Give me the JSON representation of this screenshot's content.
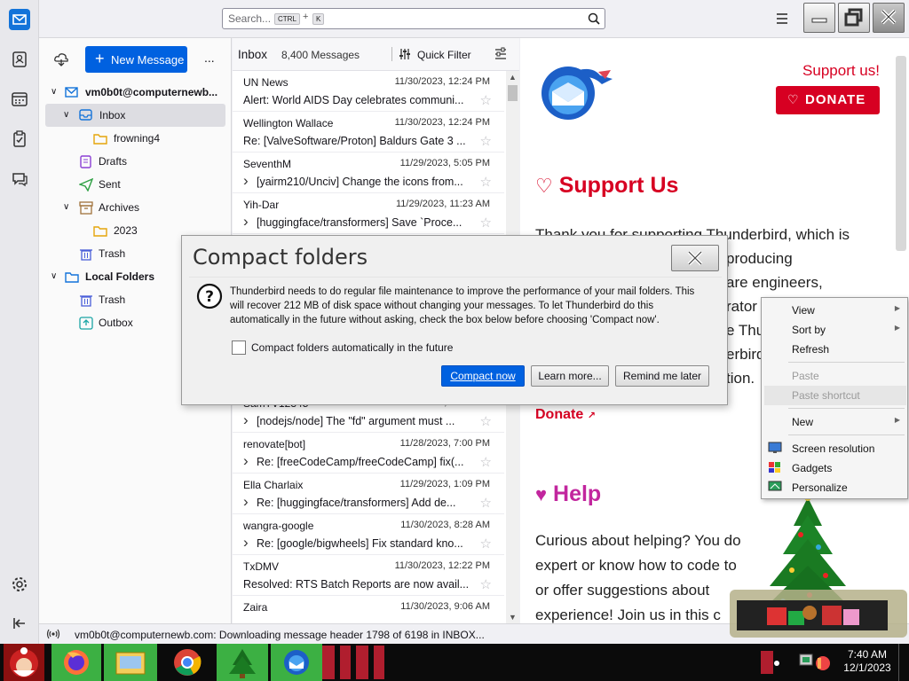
{
  "search": {
    "placeholder": "Search...",
    "kbd1": "CTRL",
    "plus": "+",
    "kbd2": "K"
  },
  "folder_pane": {
    "new_message": "New Message",
    "more": "...",
    "account": "vm0b0t@computernewb...",
    "folders": [
      {
        "label": "Inbox"
      },
      {
        "label": "frowning4"
      },
      {
        "label": "Drafts"
      },
      {
        "label": "Sent"
      },
      {
        "label": "Archives"
      },
      {
        "label": "2023"
      },
      {
        "label": "Trash"
      },
      {
        "label": "Local Folders"
      },
      {
        "label": "Trash"
      },
      {
        "label": "Outbox"
      }
    ]
  },
  "thread_pane": {
    "folder_name": "Inbox",
    "count": "8,400 Messages",
    "quick_filter": "Quick Filter",
    "messages": [
      {
        "from": "UN News",
        "date": "11/30/2023, 12:24 PM",
        "subject": "Alert: World AIDS Day celebrates communi..."
      },
      {
        "from": "Wellington Wallace",
        "date": "11/30/2023, 12:24 PM",
        "subject": "Re: [ValveSoftware/Proton] Baldurs Gate 3 ..."
      },
      {
        "from": "SeventhM",
        "date": "11/29/2023, 5:05 PM",
        "subject": "[yairm210/Unciv] Change the icons from..."
      },
      {
        "from": "Yih-Dar",
        "date": "11/29/2023, 11:23 AM",
        "subject": "[huggingface/transformers] Save `Proce..."
      },
      {
        "from": "SamTV12345",
        "date": "11/30/2023, 11:46 AM",
        "subject": "[nodejs/node] The \"fd\" argument must ..."
      },
      {
        "from": "renovate[bot]",
        "date": "11/28/2023, 7:00 PM",
        "subject": "Re: [freeCodeCamp/freeCodeCamp] fix(..."
      },
      {
        "from": "Ella Charlaix",
        "date": "11/29/2023, 1:09 PM",
        "subject": "Re: [huggingface/transformers] Add de..."
      },
      {
        "from": "wangra-google",
        "date": "11/30/2023, 8:28 AM",
        "subject": "Re: [google/bigwheels] Fix standard kno..."
      },
      {
        "from": "TxDMV",
        "date": "11/30/2023, 12:22 PM",
        "subject": "Resolved: RTS Batch Reports are now avail..."
      },
      {
        "from": "Zaira",
        "date": "11/30/2023, 9:06 AM",
        "subject": ""
      }
    ]
  },
  "content": {
    "support_us_link": "Support us!",
    "donate_button": "DONATE",
    "support_heading": "Support Us",
    "support_text": [
      "Thank you for supporting Thunderbird, which is",
      "producing",
      "are engineers,",
      "rator",
      "e Thu",
      "erbird",
      "tion."
    ],
    "donate_link": "Donate",
    "help_heading": "Help",
    "help_text": [
      "Curious about helping? You do",
      "expert or know how to code to",
      "or offer suggestions about",
      "experience! Join us in this c"
    ]
  },
  "dialog": {
    "title": "Compact folders",
    "message": "Thunderbird needs to do regular file maintenance to improve the performance of your mail folders. This will recover 212 MB of disk space without changing your messages. To let Thunderbird do this automatically in the future without asking, check the box below before choosing 'Compact now'.",
    "checkbox_label": "Compact folders automatically in the future",
    "buttons": {
      "compact": "Compact now",
      "learn": "Learn more...",
      "remind": "Remind me later"
    }
  },
  "context_menu": {
    "items": [
      {
        "label": "View"
      },
      {
        "label": "Sort by"
      },
      {
        "label": "Refresh"
      },
      {
        "label": "Paste"
      },
      {
        "label": "Paste shortcut"
      },
      {
        "label": "New"
      },
      {
        "label": "Screen resolution"
      },
      {
        "label": "Gadgets"
      },
      {
        "label": "Personalize"
      }
    ]
  },
  "status": {
    "text": "vm0b0t@computernewb.com: Downloading message header 1798 of 6198 in INBOX..."
  },
  "taskbar": {
    "time": "7:40 AM",
    "date": "12/1/2023"
  },
  "colors": {
    "accent": "#0061e0",
    "donate_red": "#d70022",
    "help_pink": "#c2269e"
  }
}
